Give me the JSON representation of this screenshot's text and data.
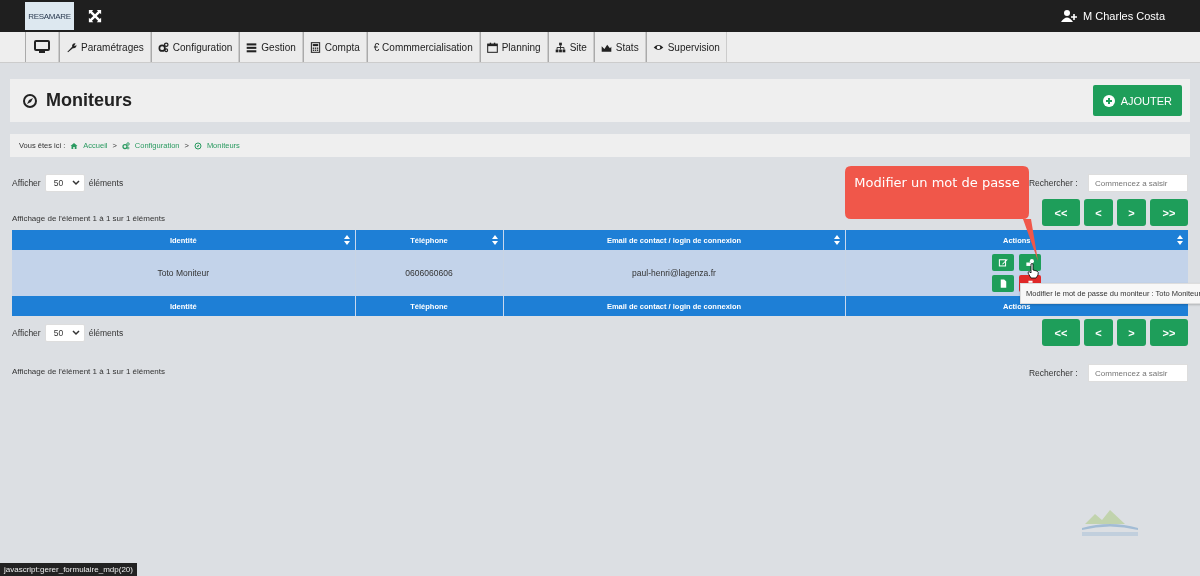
{
  "topbar": {
    "logo": "RESAMARE",
    "user": "M Charles Costa"
  },
  "nav": [
    "Paramétrages",
    "Configuration",
    "Gestion",
    "Compta",
    "€ Commmercialisation",
    "Planning",
    "Site",
    "Stats",
    "Supervision"
  ],
  "page": {
    "title": "Moniteurs",
    "add_button": "AJOUTER"
  },
  "breadcrumb": {
    "prefix": "Vous êtes ici :",
    "items": [
      "Accueil",
      "Configuration",
      "Moniteurs"
    ],
    "separator": ">"
  },
  "top_controls": {
    "show_label": "Afficher",
    "page_size": "50",
    "show_suffix": "éléments",
    "search_label": "Rechercher :",
    "search_placeholder": "Commencez a saisir",
    "info": "Affichage de l'élément 1 à 1 sur 1 éléments",
    "pager": [
      "<<",
      "<",
      ">",
      ">>"
    ]
  },
  "table": {
    "columns": [
      "Identité",
      "Téléphone",
      "Email de contact / login de connexion",
      "Actions"
    ],
    "rows": [
      {
        "highlighted": true,
        "cells": [
          "Toto Moniteur",
          "0606060606",
          "paul-henri@lagenza.fr"
        ],
        "actions": [
          {
            "kind": "edit"
          },
          {
            "kind": "password"
          },
          {
            "kind": "document"
          },
          {
            "kind": "delete"
          }
        ]
      }
    ],
    "footer": [
      "Identité",
      "Téléphone",
      "Email de contact / login de connexion",
      "Actions"
    ]
  },
  "bottom_controls": {
    "show_label": "Afficher",
    "page_size": "50",
    "show_suffix": "éléments",
    "search_label": "Rechercher :",
    "search_placeholder": "Commencez a saisir",
    "info": "Affichage de l'élément 1 à 1 sur 1 éléments",
    "pager": [
      "<<",
      "<",
      ">",
      ">>"
    ]
  },
  "callout": "Modifier un mot de passe",
  "tooltip": "Modifier le mot de passe du moniteur : Toto Moniteur",
  "status_bar": "javascript:gerer_formulaire_mdp(20)"
}
